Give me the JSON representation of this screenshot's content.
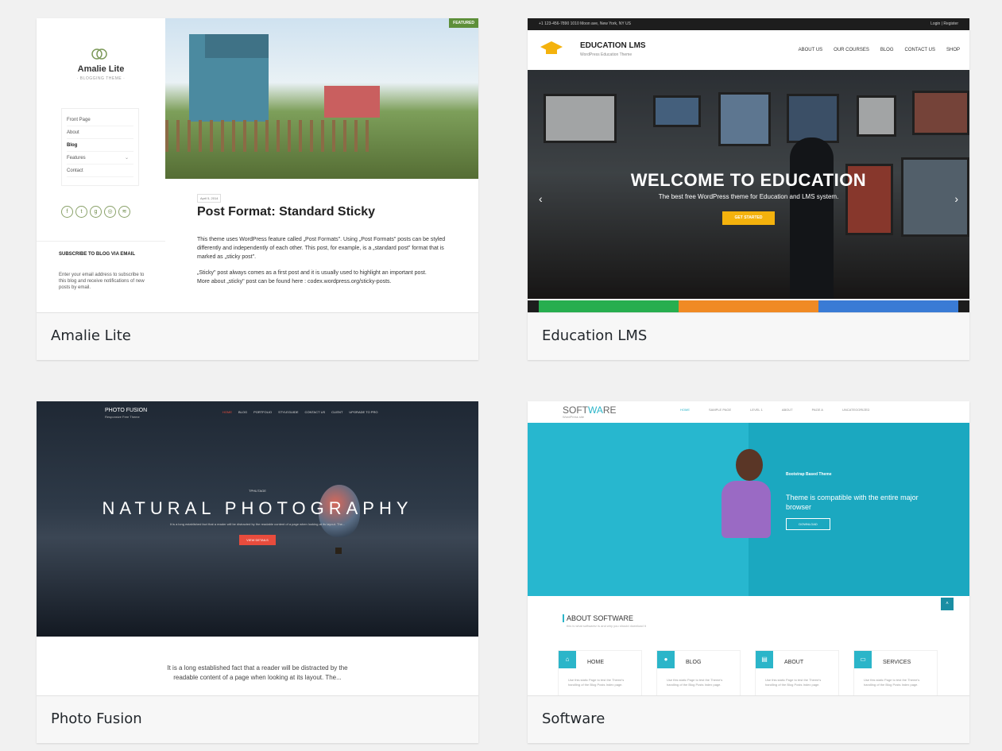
{
  "themes": [
    {
      "name": "Amalie Lite",
      "preview": {
        "site_title": "Amalie Lite",
        "tagline": "· BLOGGING THEME ·",
        "menu": [
          "Front Page",
          "About",
          "Blog",
          "Features",
          "Contact"
        ],
        "featured_badge": "FEATURED",
        "post_date": "April 5, 2014",
        "post_title": "Post Format: Standard Sticky",
        "post_para_1": "This theme uses WordPress feature called „Post Formats\". Using „Post Formats\" posts can be styled differently and independently of each other. This post, for example, is a „standard post\" format that is marked as „sticky post\".",
        "post_para_2": "„Sticky\" post always comes as a first post and it is usually used to highlight an important post.",
        "post_para_3": "More about „sticky\" post can be found here : codex.wordpress.org/sticky-posts.",
        "subscribe_title": "SUBSCRIBE TO BLOG VIA EMAIL",
        "subscribe_text": "Enter your email address to subscribe to this blog and receive notifications of new posts by email."
      }
    },
    {
      "name": "Education LMS",
      "preview": {
        "topbar_left": "+1 123-456-7890   1010 Moon ave, New York, NY US",
        "topbar_right": "Login | Register",
        "brand": "EDUCATION LMS",
        "brand_sub": "WordPress Education Theme",
        "menu": [
          "ABOUT US",
          "OUR COURSES",
          "BLOG",
          "CONTACT US",
          "SHOP"
        ],
        "hero_title": "WELCOME TO EDUCATION",
        "hero_subtitle": "The best free WordPress theme for Education and LMS system.",
        "hero_button": "GET STARTED",
        "stripe_colors": [
          "#27ae4f",
          "#f08a24",
          "#3a7bd5"
        ]
      }
    },
    {
      "name": "Photo Fusion",
      "preview": {
        "brand": "PHOTO FUSION",
        "brand_sub": "Responsive Free Theme",
        "menu": [
          "HOME",
          "BLOG",
          "PORTFOLIO",
          "STYLEGUIDE",
          "CONTACT US",
          "CLIENT",
          "UPGRADE TO PRO"
        ],
        "hero_tag": "TPHLITAGE",
        "hero_title": "NATURAL PHOTOGRAPHY",
        "hero_desc": "It is a long established fact that a reader will be distracted by the readable content of a page when looking at its layout. The...",
        "hero_button": "VIEW DETAILS",
        "body_text": "It is a long established fact that a reader will be distracted by the readable content of a page when looking at its layout. The..."
      }
    },
    {
      "name": "Software",
      "preview": {
        "logo_left": "SOFT",
        "logo_accent": "WA",
        "logo_right": "RE",
        "logo_sub": "WordPress site",
        "menu": [
          "HOME",
          "SAMPLE PAGE",
          "LEVEL 1",
          "ABOUT",
          "PAGE A",
          "UNCATEGORIZED"
        ],
        "hero_kicker": "Bootstrap Based Theme",
        "hero_headline": "Theme is compatible with the entire major browser",
        "hero_button": "DOWNLOAD",
        "about_title": "ABOUT SOFTWARE",
        "about_sub": "this is what softwarez is and why you should download it",
        "boxes": [
          {
            "title": "HOME",
            "text": "Use this static Page to test the Theme's handling of the Blog Posts Index page."
          },
          {
            "title": "BLOG",
            "text": "Use this static Page to test the Theme's handling of the Blog Posts Index page."
          },
          {
            "title": "ABOUT",
            "text": "Use this static Page to test the Theme's handling of the Blog Posts Index page."
          },
          {
            "title": "SERVICES",
            "text": "Use this static Page to test the Theme's handling of the Blog Posts Index page."
          }
        ]
      }
    }
  ],
  "colors": {
    "background": "#f1f1f1",
    "caption_bg": "#f7f7f7",
    "caption_text": "#23282d",
    "software_accent": "#2bb5c9",
    "photo_fusion_accent": "#e84c3d",
    "education_button": "#f4b20d"
  }
}
